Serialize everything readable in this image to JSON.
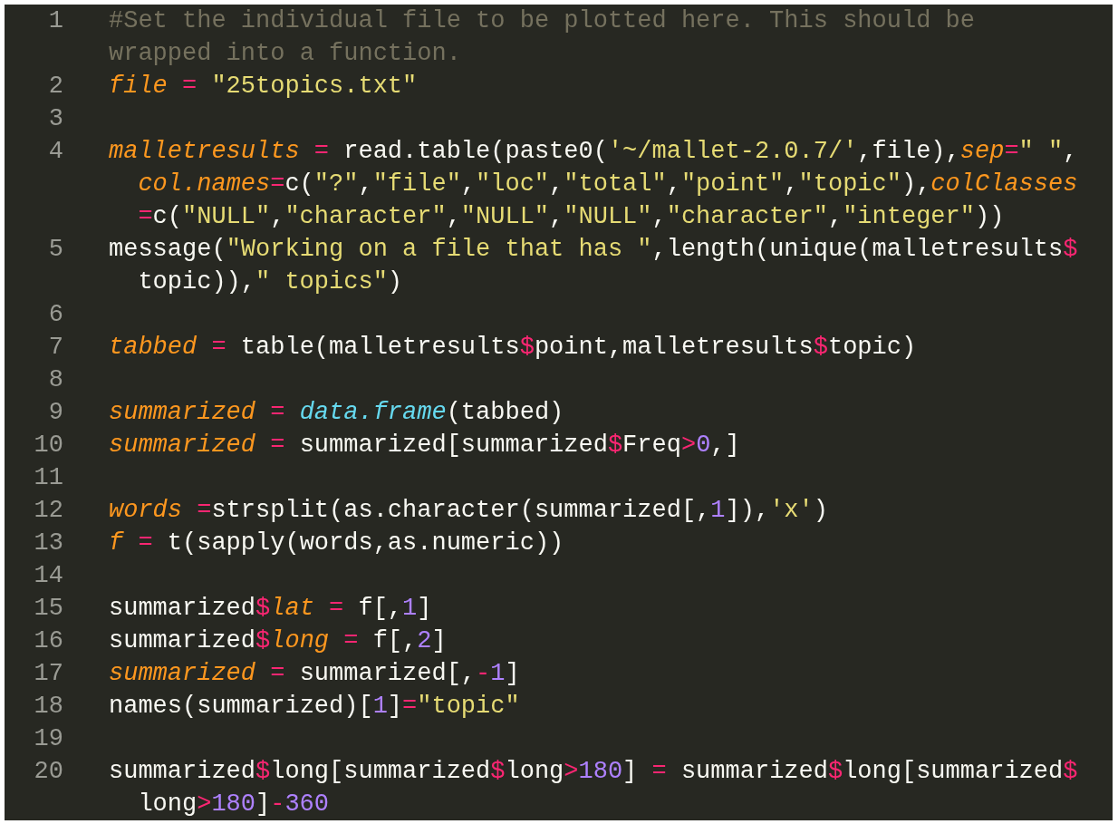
{
  "editor": {
    "lines": [
      {
        "number": "1",
        "rows": [
          {
            "indented": false,
            "tokens": [
              {
                "kind": "comment",
                "text": "#Set the individual file to be plotted here. This should be"
              }
            ]
          },
          {
            "indented": false,
            "tokens": [
              {
                "kind": "comment",
                "text": "wrapped into a function."
              }
            ]
          }
        ]
      },
      {
        "number": "2",
        "rows": [
          {
            "indented": false,
            "tokens": [
              {
                "kind": "variable",
                "text": "file"
              },
              {
                "kind": "operator",
                "text": " = "
              },
              {
                "kind": "string",
                "text": "\"25topics.txt\""
              }
            ]
          }
        ]
      },
      {
        "number": "3"
      },
      {
        "number": "4",
        "rows": [
          {
            "indented": false,
            "tokens": [
              {
                "kind": "variable",
                "text": "malletresults"
              },
              {
                "kind": "operator",
                "text": " = "
              },
              {
                "kind": "plain",
                "text": "read.table(paste0("
              },
              {
                "kind": "string",
                "text": "'~/mallet-2.0.7/'"
              },
              {
                "kind": "plain",
                "text": ",file),"
              },
              {
                "kind": "variable",
                "text": "sep"
              },
              {
                "kind": "operator",
                "text": "="
              },
              {
                "kind": "string",
                "text": "\" \""
              },
              {
                "kind": "plain",
                "text": ","
              }
            ]
          },
          {
            "indented": true,
            "tokens": [
              {
                "kind": "variable",
                "text": "col.names"
              },
              {
                "kind": "operator",
                "text": "="
              },
              {
                "kind": "plain",
                "text": "c("
              },
              {
                "kind": "string",
                "text": "\"?\""
              },
              {
                "kind": "plain",
                "text": ","
              },
              {
                "kind": "string",
                "text": "\"file\""
              },
              {
                "kind": "plain",
                "text": ","
              },
              {
                "kind": "string",
                "text": "\"loc\""
              },
              {
                "kind": "plain",
                "text": ","
              },
              {
                "kind": "string",
                "text": "\"total\""
              },
              {
                "kind": "plain",
                "text": ","
              },
              {
                "kind": "string",
                "text": "\"point\""
              },
              {
                "kind": "plain",
                "text": ","
              },
              {
                "kind": "string",
                "text": "\"topic\""
              },
              {
                "kind": "plain",
                "text": "),"
              },
              {
                "kind": "variable",
                "text": "colClasses"
              }
            ]
          },
          {
            "indented": true,
            "tokens": [
              {
                "kind": "operator",
                "text": "="
              },
              {
                "kind": "plain",
                "text": "c("
              },
              {
                "kind": "string",
                "text": "\"NULL\""
              },
              {
                "kind": "plain",
                "text": ","
              },
              {
                "kind": "string",
                "text": "\"character\""
              },
              {
                "kind": "plain",
                "text": ","
              },
              {
                "kind": "string",
                "text": "\"NULL\""
              },
              {
                "kind": "plain",
                "text": ","
              },
              {
                "kind": "string",
                "text": "\"NULL\""
              },
              {
                "kind": "plain",
                "text": ","
              },
              {
                "kind": "string",
                "text": "\"character\""
              },
              {
                "kind": "plain",
                "text": ","
              },
              {
                "kind": "string",
                "text": "\"integer\""
              },
              {
                "kind": "plain",
                "text": "))"
              }
            ]
          }
        ]
      },
      {
        "number": "5",
        "rows": [
          {
            "indented": false,
            "tokens": [
              {
                "kind": "plain",
                "text": "message("
              },
              {
                "kind": "string",
                "text": "\"Working on a file that has \""
              },
              {
                "kind": "plain",
                "text": ",length(unique(malletresults"
              },
              {
                "kind": "operator",
                "text": "$"
              }
            ]
          },
          {
            "indented": true,
            "tokens": [
              {
                "kind": "plain",
                "text": "topic)),"
              },
              {
                "kind": "string",
                "text": "\" topics\""
              },
              {
                "kind": "plain",
                "text": ")"
              }
            ]
          }
        ]
      },
      {
        "number": "6"
      },
      {
        "number": "7",
        "rows": [
          {
            "indented": false,
            "tokens": [
              {
                "kind": "variable",
                "text": "tabbed"
              },
              {
                "kind": "operator",
                "text": " = "
              },
              {
                "kind": "plain",
                "text": "table(malletresults"
              },
              {
                "kind": "operator",
                "text": "$"
              },
              {
                "kind": "plain",
                "text": "point,malletresults"
              },
              {
                "kind": "operator",
                "text": "$"
              },
              {
                "kind": "plain",
                "text": "topic)"
              }
            ]
          }
        ]
      },
      {
        "number": "8"
      },
      {
        "number": "9",
        "rows": [
          {
            "indented": false,
            "tokens": [
              {
                "kind": "variable",
                "text": "summarized"
              },
              {
                "kind": "operator",
                "text": " = "
              },
              {
                "kind": "function",
                "text": "data.frame"
              },
              {
                "kind": "plain",
                "text": "(tabbed)"
              }
            ]
          }
        ]
      },
      {
        "number": "10",
        "rows": [
          {
            "indented": false,
            "tokens": [
              {
                "kind": "variable",
                "text": "summarized"
              },
              {
                "kind": "operator",
                "text": " = "
              },
              {
                "kind": "plain",
                "text": "summarized[summarized"
              },
              {
                "kind": "operator",
                "text": "$"
              },
              {
                "kind": "plain",
                "text": "Freq"
              },
              {
                "kind": "operator",
                "text": ">"
              },
              {
                "kind": "number",
                "text": "0"
              },
              {
                "kind": "plain",
                "text": ",]"
              }
            ]
          }
        ]
      },
      {
        "number": "11"
      },
      {
        "number": "12",
        "rows": [
          {
            "indented": false,
            "tokens": [
              {
                "kind": "variable",
                "text": "words"
              },
              {
                "kind": "operator",
                "text": " ="
              },
              {
                "kind": "plain",
                "text": "strsplit(as.character(summarized[,"
              },
              {
                "kind": "number",
                "text": "1"
              },
              {
                "kind": "plain",
                "text": "]),"
              },
              {
                "kind": "string",
                "text": "'x'"
              },
              {
                "kind": "plain",
                "text": ")"
              }
            ]
          }
        ]
      },
      {
        "number": "13",
        "rows": [
          {
            "indented": false,
            "tokens": [
              {
                "kind": "variable",
                "text": "f"
              },
              {
                "kind": "operator",
                "text": " = "
              },
              {
                "kind": "plain",
                "text": "t(sapply(words,as.numeric))"
              }
            ]
          }
        ]
      },
      {
        "number": "14"
      },
      {
        "number": "15",
        "rows": [
          {
            "indented": false,
            "tokens": [
              {
                "kind": "plain",
                "text": "summarized"
              },
              {
                "kind": "operator",
                "text": "$"
              },
              {
                "kind": "variable",
                "text": "lat"
              },
              {
                "kind": "operator",
                "text": " = "
              },
              {
                "kind": "plain",
                "text": "f[,"
              },
              {
                "kind": "number",
                "text": "1"
              },
              {
                "kind": "plain",
                "text": "]"
              }
            ]
          }
        ]
      },
      {
        "number": "16",
        "rows": [
          {
            "indented": false,
            "tokens": [
              {
                "kind": "plain",
                "text": "summarized"
              },
              {
                "kind": "operator",
                "text": "$"
              },
              {
                "kind": "variable",
                "text": "long"
              },
              {
                "kind": "operator",
                "text": " = "
              },
              {
                "kind": "plain",
                "text": "f[,"
              },
              {
                "kind": "number",
                "text": "2"
              },
              {
                "kind": "plain",
                "text": "]"
              }
            ]
          }
        ]
      },
      {
        "number": "17",
        "rows": [
          {
            "indented": false,
            "tokens": [
              {
                "kind": "variable",
                "text": "summarized"
              },
              {
                "kind": "operator",
                "text": " = "
              },
              {
                "kind": "plain",
                "text": "summarized[,"
              },
              {
                "kind": "operator",
                "text": "-"
              },
              {
                "kind": "number",
                "text": "1"
              },
              {
                "kind": "plain",
                "text": "]"
              }
            ]
          }
        ]
      },
      {
        "number": "18",
        "rows": [
          {
            "indented": false,
            "tokens": [
              {
                "kind": "plain",
                "text": "names(summarized)["
              },
              {
                "kind": "number",
                "text": "1"
              },
              {
                "kind": "plain",
                "text": "]"
              },
              {
                "kind": "operator",
                "text": "="
              },
              {
                "kind": "string",
                "text": "\"topic\""
              }
            ]
          }
        ]
      },
      {
        "number": "19"
      },
      {
        "number": "20",
        "rows": [
          {
            "indented": false,
            "tokens": [
              {
                "kind": "plain",
                "text": "summarized"
              },
              {
                "kind": "operator",
                "text": "$"
              },
              {
                "kind": "plain",
                "text": "long[summarized"
              },
              {
                "kind": "operator",
                "text": "$"
              },
              {
                "kind": "plain",
                "text": "long"
              },
              {
                "kind": "operator",
                "text": ">"
              },
              {
                "kind": "number",
                "text": "180"
              },
              {
                "kind": "plain",
                "text": "]"
              },
              {
                "kind": "operator",
                "text": " = "
              },
              {
                "kind": "plain",
                "text": "summarized"
              },
              {
                "kind": "operator",
                "text": "$"
              },
              {
                "kind": "plain",
                "text": "long[summarized"
              },
              {
                "kind": "operator",
                "text": "$"
              }
            ]
          },
          {
            "indented": true,
            "tokens": [
              {
                "kind": "plain",
                "text": "long"
              },
              {
                "kind": "operator",
                "text": ">"
              },
              {
                "kind": "number",
                "text": "180"
              },
              {
                "kind": "plain",
                "text": "]"
              },
              {
                "kind": "operator",
                "text": "-"
              },
              {
                "kind": "number",
                "text": "360"
              }
            ]
          }
        ]
      }
    ]
  }
}
